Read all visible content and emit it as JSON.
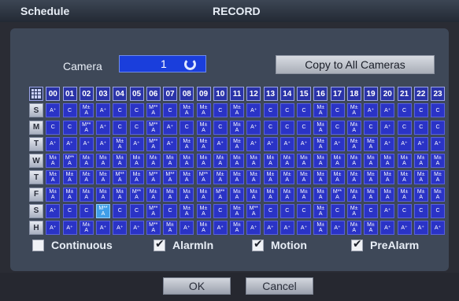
{
  "window": {
    "section": "Schedule",
    "title": "RECORD"
  },
  "camera": {
    "label": "Camera",
    "value": "1"
  },
  "copy_button": "Copy to All Cameras",
  "hours": [
    "00",
    "01",
    "02",
    "03",
    "04",
    "05",
    "06",
    "07",
    "08",
    "09",
    "10",
    "11",
    "12",
    "13",
    "14",
    "15",
    "16",
    "17",
    "18",
    "19",
    "20",
    "21",
    "22",
    "23"
  ],
  "days": [
    "S",
    "M",
    "T",
    "W",
    "T",
    "F",
    "S",
    "H"
  ],
  "schedule": [
    [
      "A⁺",
      "C",
      "M±A",
      "A⁺",
      "C",
      "C",
      "M**A",
      "C",
      "M±A",
      "M±A",
      "C",
      "M±A",
      "A⁺",
      "C",
      "C",
      "C",
      "M±A",
      "C",
      "M±A",
      "A⁺",
      "A⁺",
      "C",
      "C",
      "C"
    ],
    [
      "C",
      "C",
      "M**A",
      "A⁺",
      "C",
      "C",
      "M**A",
      "A⁺",
      "C",
      "M±A",
      "C",
      "M±A",
      "A⁺",
      "C",
      "C",
      "C",
      "M±A",
      "C",
      "M±A",
      "C",
      "A⁺",
      "C",
      "C",
      "C"
    ],
    [
      "A⁺",
      "A⁺",
      "A⁺",
      "A⁺",
      "M±A",
      "A⁺",
      "M**A",
      "A⁺",
      "M±A",
      "M±A",
      "A⁺",
      "M±A",
      "A⁺",
      "A⁺",
      "A⁺",
      "A⁺",
      "M±A",
      "A⁺",
      "M±A",
      "M±A",
      "A⁺",
      "A⁺",
      "A⁺",
      "A⁺"
    ],
    [
      "M±A",
      "M**A",
      "M±A",
      "M±A",
      "M±A",
      "M±A",
      "M±A",
      "M±A",
      "M±A",
      "M±A",
      "M±A",
      "M±A",
      "M±A",
      "M±A",
      "M±A",
      "M±A",
      "M±A",
      "M±A",
      "M±A",
      "M±A",
      "M±A",
      "M±A",
      "M±A",
      "M±A"
    ],
    [
      "M±A",
      "M±A",
      "M±A",
      "M±A",
      "M**A",
      "M±A",
      "M**A",
      "M**A",
      "M±A",
      "M**A",
      "M±A",
      "M±A",
      "M±A",
      "M±A",
      "M±A",
      "M±A",
      "M±A",
      "M±A",
      "M±A",
      "M±A",
      "M±A",
      "M±A",
      "M±A",
      "M±A"
    ],
    [
      "M±A",
      "M±A",
      "M±A",
      "M±A",
      "M±A",
      "M**A",
      "M±A",
      "M±A",
      "M±A",
      "M±A",
      "M**A",
      "M±A",
      "M±A",
      "M±A",
      "M±A",
      "M±A",
      "M±A",
      "M**A",
      "M±A",
      "M±A",
      "M±A",
      "M±A",
      "M±A",
      "M±A"
    ],
    [
      "A⁺",
      "C",
      "C",
      "M**A",
      "C",
      "C",
      "M**A",
      "C",
      "M±A",
      "M±A",
      "C",
      "M±A",
      "M**A",
      "C",
      "C",
      "C",
      "M±A",
      "C",
      "M±A",
      "C",
      "A⁺",
      "C",
      "C",
      "C"
    ],
    [
      "A⁺",
      "A⁺",
      "M±A",
      "A⁺",
      "A⁺",
      "A⁺",
      "M**A",
      "M±A",
      "A⁺",
      "M±A",
      "A⁺",
      "M±A",
      "A⁺",
      "A⁺",
      "A⁺",
      "A⁺",
      "M±A",
      "A⁺",
      "M±A",
      "M±A",
      "A⁺",
      "A⁺",
      "A⁺",
      "A⁺"
    ]
  ],
  "selected_cell": {
    "day_index": 6,
    "hour_index": 3
  },
  "options": [
    {
      "label": "Continuous",
      "checked": false
    },
    {
      "label": "AlarmIn",
      "checked": true
    },
    {
      "label": "Motion",
      "checked": true
    },
    {
      "label": "PreAlarm",
      "checked": true
    }
  ],
  "buttons": {
    "ok": "OK",
    "cancel": "Cancel"
  },
  "colors": {
    "cell": "#2a33c6",
    "selected_cell": "#3f9ee8",
    "header": "#2a33a8",
    "panel": "#3e4858"
  }
}
